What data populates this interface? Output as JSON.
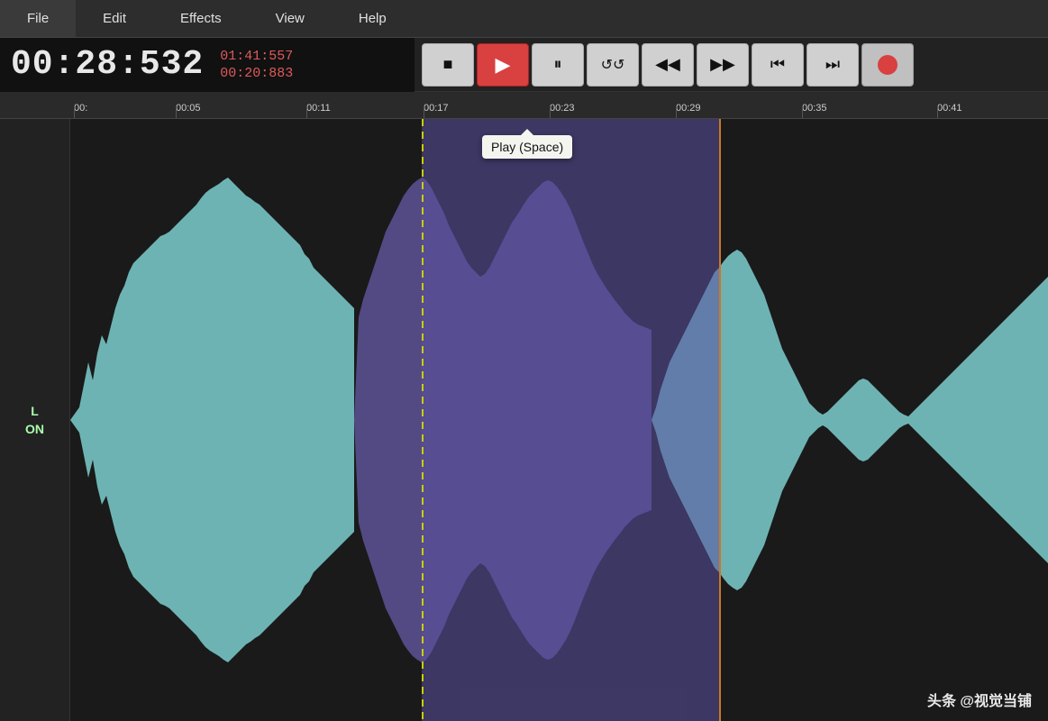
{
  "menubar": {
    "items": [
      "File",
      "Edit",
      "Effects",
      "View",
      "Help"
    ]
  },
  "timer": {
    "main_time": "00:28:532",
    "sub_time1": "01:41:557",
    "sub_time2": "00:20:883"
  },
  "transport": {
    "stop_label": "■",
    "play_label": "▶",
    "pause_label": "⏸",
    "loop_label": "🔁",
    "rewind_label": "◀◀",
    "forward_label": "▶▶",
    "skip_start_label": "⏮",
    "skip_end_label": "⏭",
    "record_label": ""
  },
  "tooltip": {
    "play_tooltip": "Play (Space)"
  },
  "ruler": {
    "labels": [
      "00:",
      "00:05",
      "00:11",
      "00:17",
      "00:23",
      "00:29",
      "00:35",
      "00:41"
    ]
  },
  "track": {
    "channel": "L",
    "status": "ON"
  },
  "watermark": "头条 @视觉当铺"
}
